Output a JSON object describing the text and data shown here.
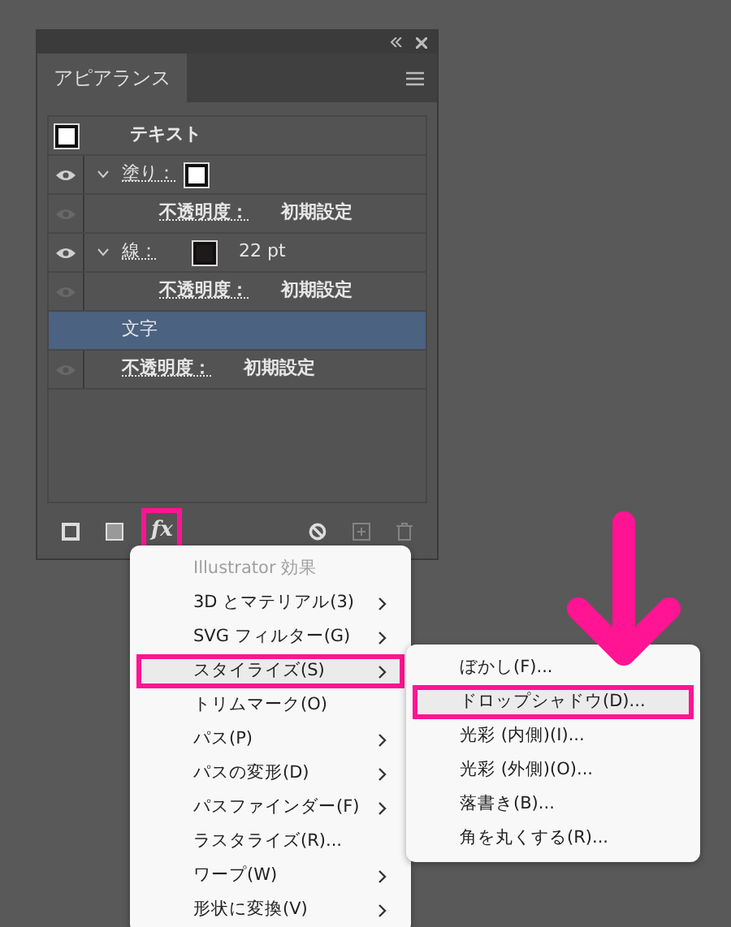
{
  "panel": {
    "tabs": [
      {
        "label": "アピアランス",
        "selected": true
      }
    ],
    "object": {
      "label": "テキスト",
      "color": "#ffffff"
    },
    "rows": [
      {
        "kind": "fill",
        "label": "塗り：",
        "visible": true,
        "expanded": true,
        "selected": false,
        "color": "#ffffff",
        "children": [
          {
            "kind": "opacity",
            "label": "不透明度：",
            "value": "初期設定",
            "visible": false,
            "selected": false
          }
        ]
      },
      {
        "kind": "stroke",
        "label": "線：",
        "visible": true,
        "expanded": true,
        "selected": false,
        "color": "#1e1a1a",
        "value": "22 pt",
        "children": [
          {
            "kind": "opacity",
            "label": "不透明度：",
            "value": "初期設定",
            "visible": false,
            "selected": false
          }
        ]
      },
      {
        "kind": "characters",
        "label": "文字",
        "selected": true
      },
      {
        "kind": "opacity",
        "label": "不透明度：",
        "value": "初期設定",
        "visible": false,
        "selected": false
      }
    ],
    "footer_buttons": [
      {
        "kind": "new-stroke",
        "disabled": false,
        "highlighted": false
      },
      {
        "kind": "new-fill",
        "disabled": false,
        "highlighted": false
      },
      {
        "kind": "fx",
        "label": "fx",
        "disabled": false,
        "highlighted": true
      },
      {
        "kind": "clear",
        "disabled": false,
        "highlighted": false
      },
      {
        "kind": "duplicate",
        "disabled": true,
        "highlighted": false
      },
      {
        "kind": "delete",
        "disabled": true,
        "highlighted": false
      }
    ]
  },
  "menu": {
    "title": "Illustrator 効果",
    "items": [
      {
        "label": "3D とマテリアル(3)",
        "submenu": true,
        "selected": false,
        "highlighted": false
      },
      {
        "label": "SVG フィルター(G)",
        "submenu": true,
        "selected": false,
        "highlighted": false
      },
      {
        "label": "スタイライズ(S)",
        "submenu": true,
        "selected": true,
        "highlighted": true
      },
      {
        "label": "トリムマーク(O)",
        "submenu": false,
        "selected": false,
        "highlighted": false
      },
      {
        "label": "パス(P)",
        "submenu": true,
        "selected": false,
        "highlighted": false
      },
      {
        "label": "パスの変形(D)",
        "submenu": true,
        "selected": false,
        "highlighted": false
      },
      {
        "label": "パスファインダー(F)",
        "submenu": true,
        "selected": false,
        "highlighted": false
      },
      {
        "label": "ラスタライズ(R)...",
        "submenu": false,
        "selected": false,
        "highlighted": false
      },
      {
        "label": "ワープ(W)",
        "submenu": true,
        "selected": false,
        "highlighted": false
      },
      {
        "label": "形状に変換(V)",
        "submenu": true,
        "selected": false,
        "highlighted": false
      }
    ]
  },
  "submenu": {
    "items": [
      {
        "label": "ぼかし(F)...",
        "selected": false,
        "highlighted": false
      },
      {
        "label": "ドロップシャドウ(D)...",
        "selected": true,
        "highlighted": true
      },
      {
        "label": "光彩 (内側)(I)...",
        "selected": false,
        "highlighted": false
      },
      {
        "label": "光彩 (外側)(O)...",
        "selected": false,
        "highlighted": false
      },
      {
        "label": "落書き(B)...",
        "selected": false,
        "highlighted": false
      },
      {
        "label": "角を丸くする(R)...",
        "selected": false,
        "highlighted": false
      }
    ]
  }
}
